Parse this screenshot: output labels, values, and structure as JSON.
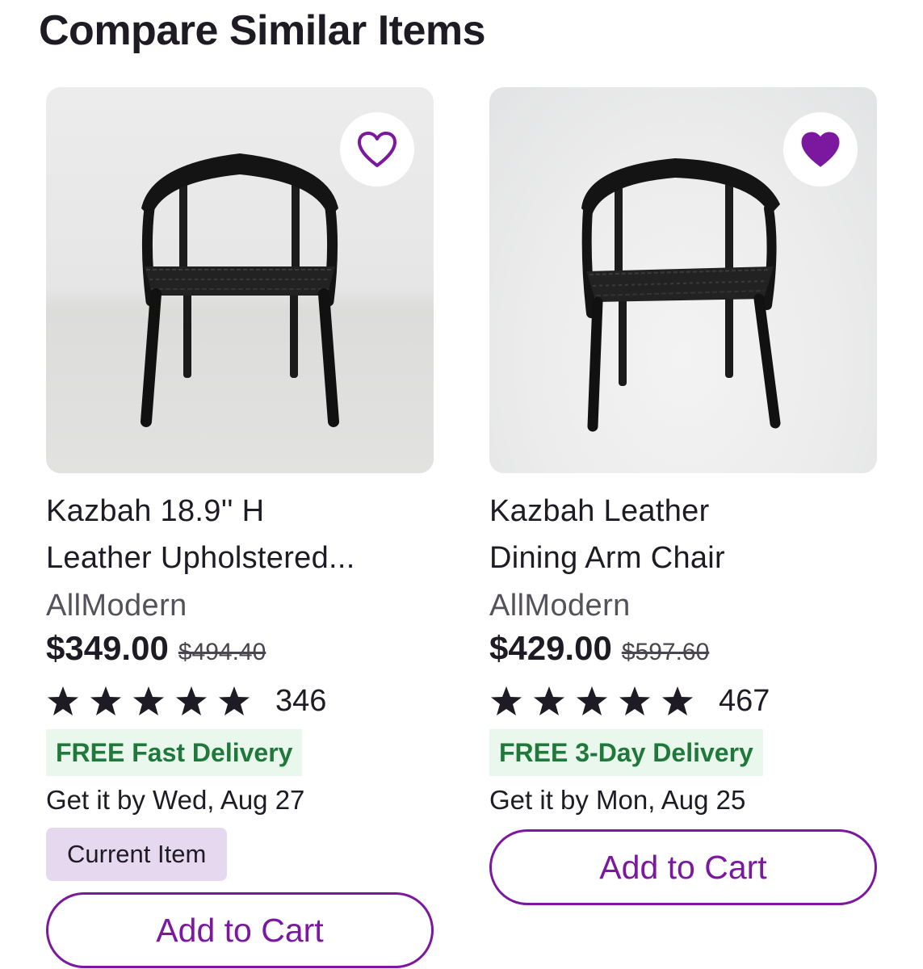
{
  "section": {
    "title": "Compare Similar Items"
  },
  "colors": {
    "accent": "#7b189f",
    "delivery_text": "#20783b",
    "delivery_bg": "#e9f7ec",
    "current_badge_bg": "#e6d9ef"
  },
  "products": [
    {
      "title_line1": "Kazbah 18.9'' H",
      "title_line2": "Leather Upholstered...",
      "brand": "AllModern",
      "price": "$349.00",
      "old_price": "$494.40",
      "rating_stars": 5,
      "review_count": "346",
      "delivery": "FREE Fast Delivery",
      "delivery_date": "Get it by Wed, Aug 27",
      "current_item_label": "Current Item",
      "cart_label": "Add to Cart",
      "favorite_icon": "heart-outline-icon",
      "favorited": false
    },
    {
      "title_line1": "Kazbah Leather",
      "title_line2": "Dining Arm Chair",
      "brand": "AllModern",
      "price": "$429.00",
      "old_price": "$597.60",
      "rating_stars": 5,
      "review_count": "467",
      "delivery": "FREE 3-Day Delivery",
      "delivery_date": "Get it by Mon, Aug 25",
      "cart_label": "Add to Cart",
      "favorite_icon": "heart-filled-icon",
      "favorited": true
    }
  ]
}
